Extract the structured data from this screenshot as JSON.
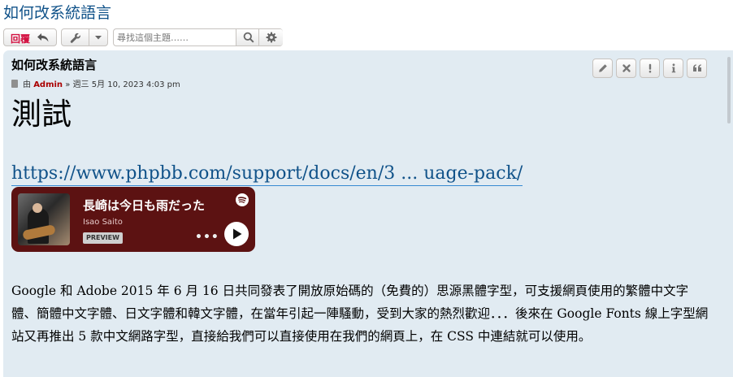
{
  "topic": {
    "title": "如何改系統語言"
  },
  "action_bar": {
    "reply_label": "回覆",
    "search_placeholder": "尋找這個主題……"
  },
  "post": {
    "title": "如何改系統語言",
    "meta": {
      "prefix": "由",
      "author": "Admin",
      "separator": "»",
      "date": "週三 5月 10, 2023 4:03 pm"
    },
    "actions": [
      "edit-icon",
      "delete-icon",
      "report-icon",
      "info-icon",
      "quote-icon"
    ],
    "heading": "測試",
    "link_text": "https://www.phpbb.com/support/docs/en/3 ... uage-pack/",
    "spotify": {
      "track_title": "長崎は今日も雨だった",
      "artist": "Isao Saito",
      "badge": "PREVIEW",
      "more": "•••",
      "bg_color": "#5c1212"
    },
    "paragraph": "Google 和 Adobe 2015 年 6 月 16 日共同發表了開放原始碼的（免費的）思源黑體字型，可支援網頁使用的繁體中文字體、簡體中文字體、日文字體和韓文字體，在當年引起一陣騷動，受到大家的熱烈歡迎．．．後來在 Google Fonts 線上字型網站又再推出 5 款中文網路字型，直接給我們可以直接使用在我們的網頁上，在 CSS 中連結就可以使用。"
  },
  "colors": {
    "link": "#105289",
    "post_bg": "#e1ebf2",
    "author": "#aa0000",
    "reply": "#d31141"
  }
}
